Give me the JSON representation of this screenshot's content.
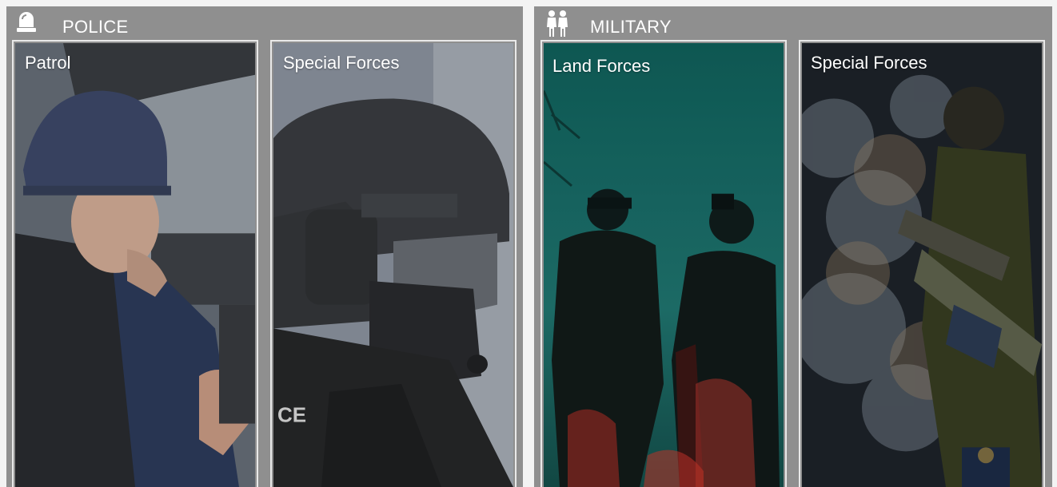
{
  "sections": {
    "police": {
      "title": "POLICE",
      "icon": "siren-icon",
      "cards": [
        {
          "label": "Patrol"
        },
        {
          "label": "Special Forces"
        }
      ]
    },
    "military": {
      "title": "MILITARY",
      "icon": "soldiers-icon",
      "cards": [
        {
          "label": "Land Forces"
        },
        {
          "label": "Special Forces"
        }
      ]
    }
  },
  "colors": {
    "panel_background": "#8f8f8f",
    "card_border": "#e9e9e9",
    "text": "#ffffff",
    "teal_sky": "#1d6a66",
    "red_glow": "#c8352a"
  }
}
